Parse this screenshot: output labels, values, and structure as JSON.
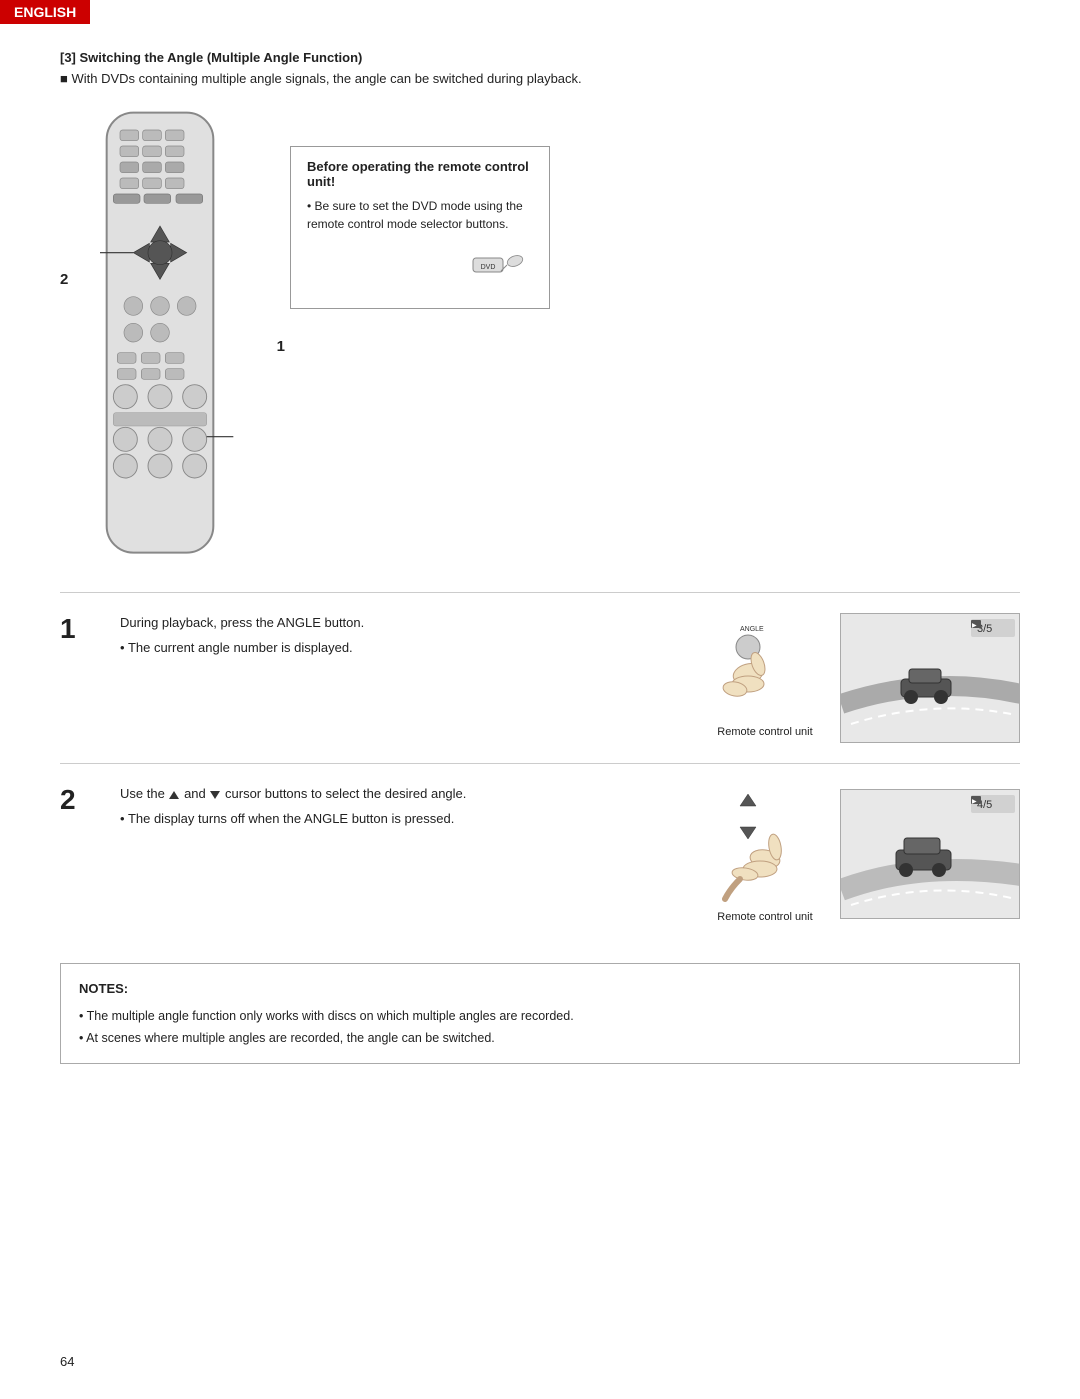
{
  "header": {
    "badge": "ENGLISH"
  },
  "section": {
    "number": "[3]",
    "title": "[3] Switching the Angle (Multiple Angle Function)",
    "intro": "With DVDs containing multiple angle signals, the angle can be switched during playback."
  },
  "before_box": {
    "title": "Before operating the remote control unit!",
    "bullet": "Be sure to set the DVD mode using the remote control mode selector buttons.",
    "dvd_label": "DVD"
  },
  "diagram_labels": {
    "label1": "1",
    "label2": "2"
  },
  "step1": {
    "number": "1",
    "main_text": "During playback, press the ANGLE button.",
    "bullet": "The current angle number is displayed.",
    "remote_label": "Remote control unit",
    "screen_badge": "3/5"
  },
  "step2": {
    "number": "2",
    "main_text_prefix": "Use the",
    "cursor_up_label": "▲",
    "and_text": "and",
    "cursor_down_label": "▼",
    "main_text_suffix": "cursor buttons to select the desired angle.",
    "bullet": "The display turns off when the ANGLE button is pressed.",
    "remote_label": "Remote control unit",
    "screen_badge": "4/5"
  },
  "notes": {
    "title": "NOTES:",
    "items": [
      "The multiple angle function only works with discs on which multiple angles are recorded.",
      "At scenes where multiple angles are recorded, the angle can be switched."
    ]
  },
  "page_number": "64"
}
